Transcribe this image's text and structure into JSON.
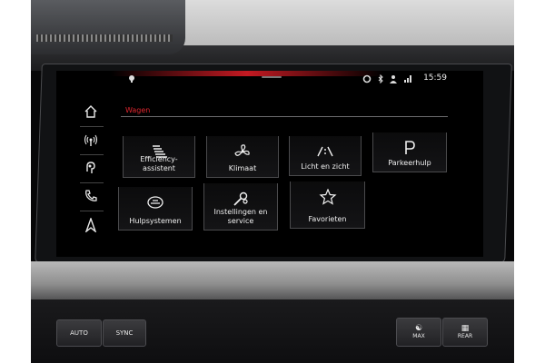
{
  "status": {
    "time": "15:59"
  },
  "section": {
    "title": "Wagen"
  },
  "sidebar": {
    "items": [
      {
        "icon": "home-icon"
      },
      {
        "icon": "radio-icon"
      },
      {
        "icon": "audio-source-icon"
      },
      {
        "icon": "phone-icon"
      },
      {
        "icon": "navigation-icon"
      }
    ]
  },
  "tiles": [
    {
      "label": "Efficiency-\nassistent",
      "icon": "efficiency-icon"
    },
    {
      "label": "Klimaat",
      "icon": "fan-icon"
    },
    {
      "label": "Licht en zicht",
      "icon": "light-icon"
    },
    {
      "label": "Parkeerhulp",
      "icon": "parking-icon"
    },
    {
      "label": "Hulpsystemen",
      "icon": "assist-systems-icon"
    },
    {
      "label": "Instellingen en\nservice",
      "icon": "settings-wrench-icon"
    },
    {
      "label": "Favorieten",
      "icon": "star-icon"
    }
  ],
  "hardware": {
    "auto": "AUTO",
    "sync": "SYNC",
    "max": "MAX",
    "rear": "REAR"
  },
  "colors": {
    "accent": "#e0262f",
    "text": "#f0f0f0"
  }
}
